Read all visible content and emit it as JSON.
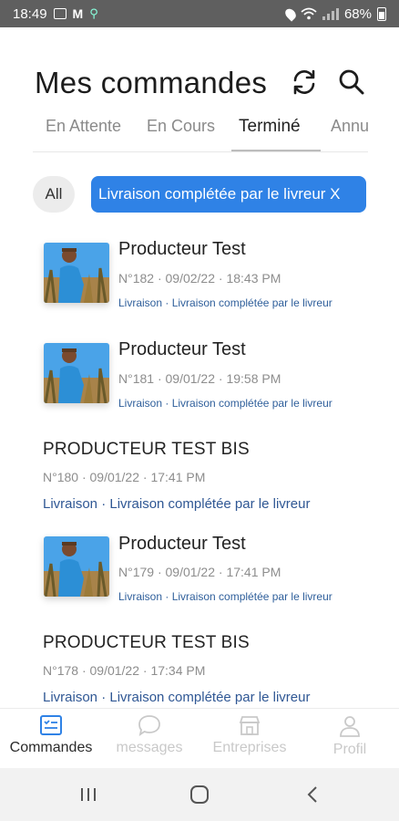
{
  "status_bar": {
    "time": "18:49",
    "battery": "68%"
  },
  "header": {
    "title": "Mes commandes"
  },
  "tabs": [
    {
      "label": "En Attente",
      "active": false
    },
    {
      "label": "En Cours",
      "active": false
    },
    {
      "label": "Terminé",
      "active": true
    },
    {
      "label": "Annu",
      "active": false
    }
  ],
  "filters": {
    "all_label": "All",
    "selected_label": "Livraison complétée par le livreur X"
  },
  "orders": [
    {
      "name": "Producteur Test",
      "meta": "N°182 · 09/02/22 · 18:43 PM",
      "status": "Livraison · Livraison complétée par le livreur",
      "has_image": true
    },
    {
      "name": "Producteur Test",
      "meta": "N°181 · 09/01/22 · 19:58 PM",
      "status": "Livraison · Livraison complétée par le livreur",
      "has_image": true
    },
    {
      "name": "PRODUCTEUR TEST BIS",
      "meta": "N°180 · 09/01/22 · 17:41 PM",
      "status": "Livraison · Livraison complétée par le livreur",
      "has_image": false
    },
    {
      "name": "Producteur Test",
      "meta": "N°179 · 09/01/22 · 17:41 PM",
      "status": "Livraison · Livraison complétée par le livreur",
      "has_image": true
    },
    {
      "name": "PRODUCTEUR TEST BIS",
      "meta": "N°178 · 09/01/22 · 17:34 PM",
      "status": "Livraison · Livraison complétée par le livreur",
      "has_image": false
    }
  ],
  "bottom_nav": [
    {
      "label": "Commandes",
      "icon": "orders-list-icon",
      "active": true
    },
    {
      "label": "messages",
      "icon": "chat-bubble-icon",
      "active": false
    },
    {
      "label": "Entreprises",
      "icon": "store-icon",
      "active": false
    },
    {
      "label": "Profil",
      "icon": "user-icon",
      "active": false
    }
  ],
  "colors": {
    "accent": "#2f82e6",
    "status_link": "#2f5f9b",
    "status_bar_bg": "#5f5f5f"
  }
}
